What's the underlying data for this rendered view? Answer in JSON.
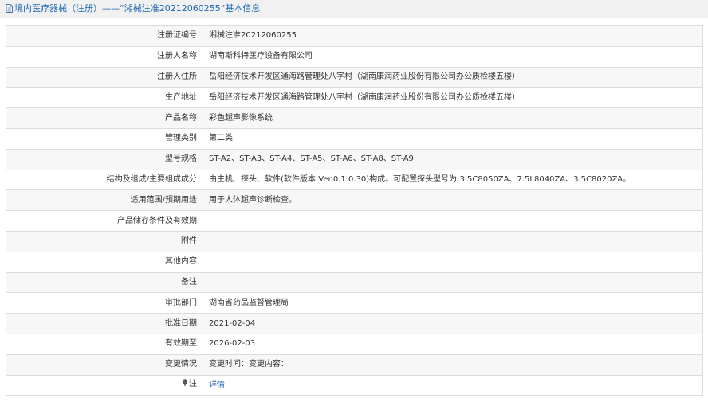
{
  "header": {
    "title": "境内医疗器械（注册）——“湘械注准20212060255”基本信息"
  },
  "rows": [
    {
      "label": "注册证编号",
      "value": "湘械注准20212060255"
    },
    {
      "label": "注册人名称",
      "value": "湖南斯科特医疗设备有限公司"
    },
    {
      "label": "注册人住所",
      "value": "岳阳经济技术开发区通海路管理处八字村（湖南康润药业股份有限公司办公质检楼五楼）"
    },
    {
      "label": "生产地址",
      "value": "岳阳经济技术开发区通海路管理处八字村（湖南康润药业股份有限公司办公质检楼五楼）"
    },
    {
      "label": "产品名称",
      "value": "彩色超声影像系统"
    },
    {
      "label": "管理类别",
      "value": "第二类"
    },
    {
      "label": "型号规格",
      "value": "ST-A2、ST-A3、ST-A4、ST-A5、ST-A6、ST-A8、ST-A9"
    },
    {
      "label": "结构及组成/主要组成成分",
      "value": "由主机、探头、软件(软件版本:Ver.0.1.0.30)构成。可配置探头型号为:3.5C8050ZA、7.5L8040ZA、3.5C8020ZA。"
    },
    {
      "label": "适用范围/预期用途",
      "value": "用于人体超声诊断检查。"
    },
    {
      "label": "产品储存条件及有效期",
      "value": ""
    },
    {
      "label": "附件",
      "value": ""
    },
    {
      "label": "其他内容",
      "value": ""
    },
    {
      "label": "备注",
      "value": ""
    },
    {
      "label": "审批部门",
      "value": "湖南省药品监督管理局"
    },
    {
      "label": "批准日期",
      "value": "2021-02-04"
    },
    {
      "label": "有效期至",
      "value": "2026-02-03"
    },
    {
      "label": "变更情况",
      "value": "变更时间：变更内容："
    }
  ],
  "note_row": {
    "label": "注",
    "icon": "pin-icon",
    "link_text": "详情"
  }
}
